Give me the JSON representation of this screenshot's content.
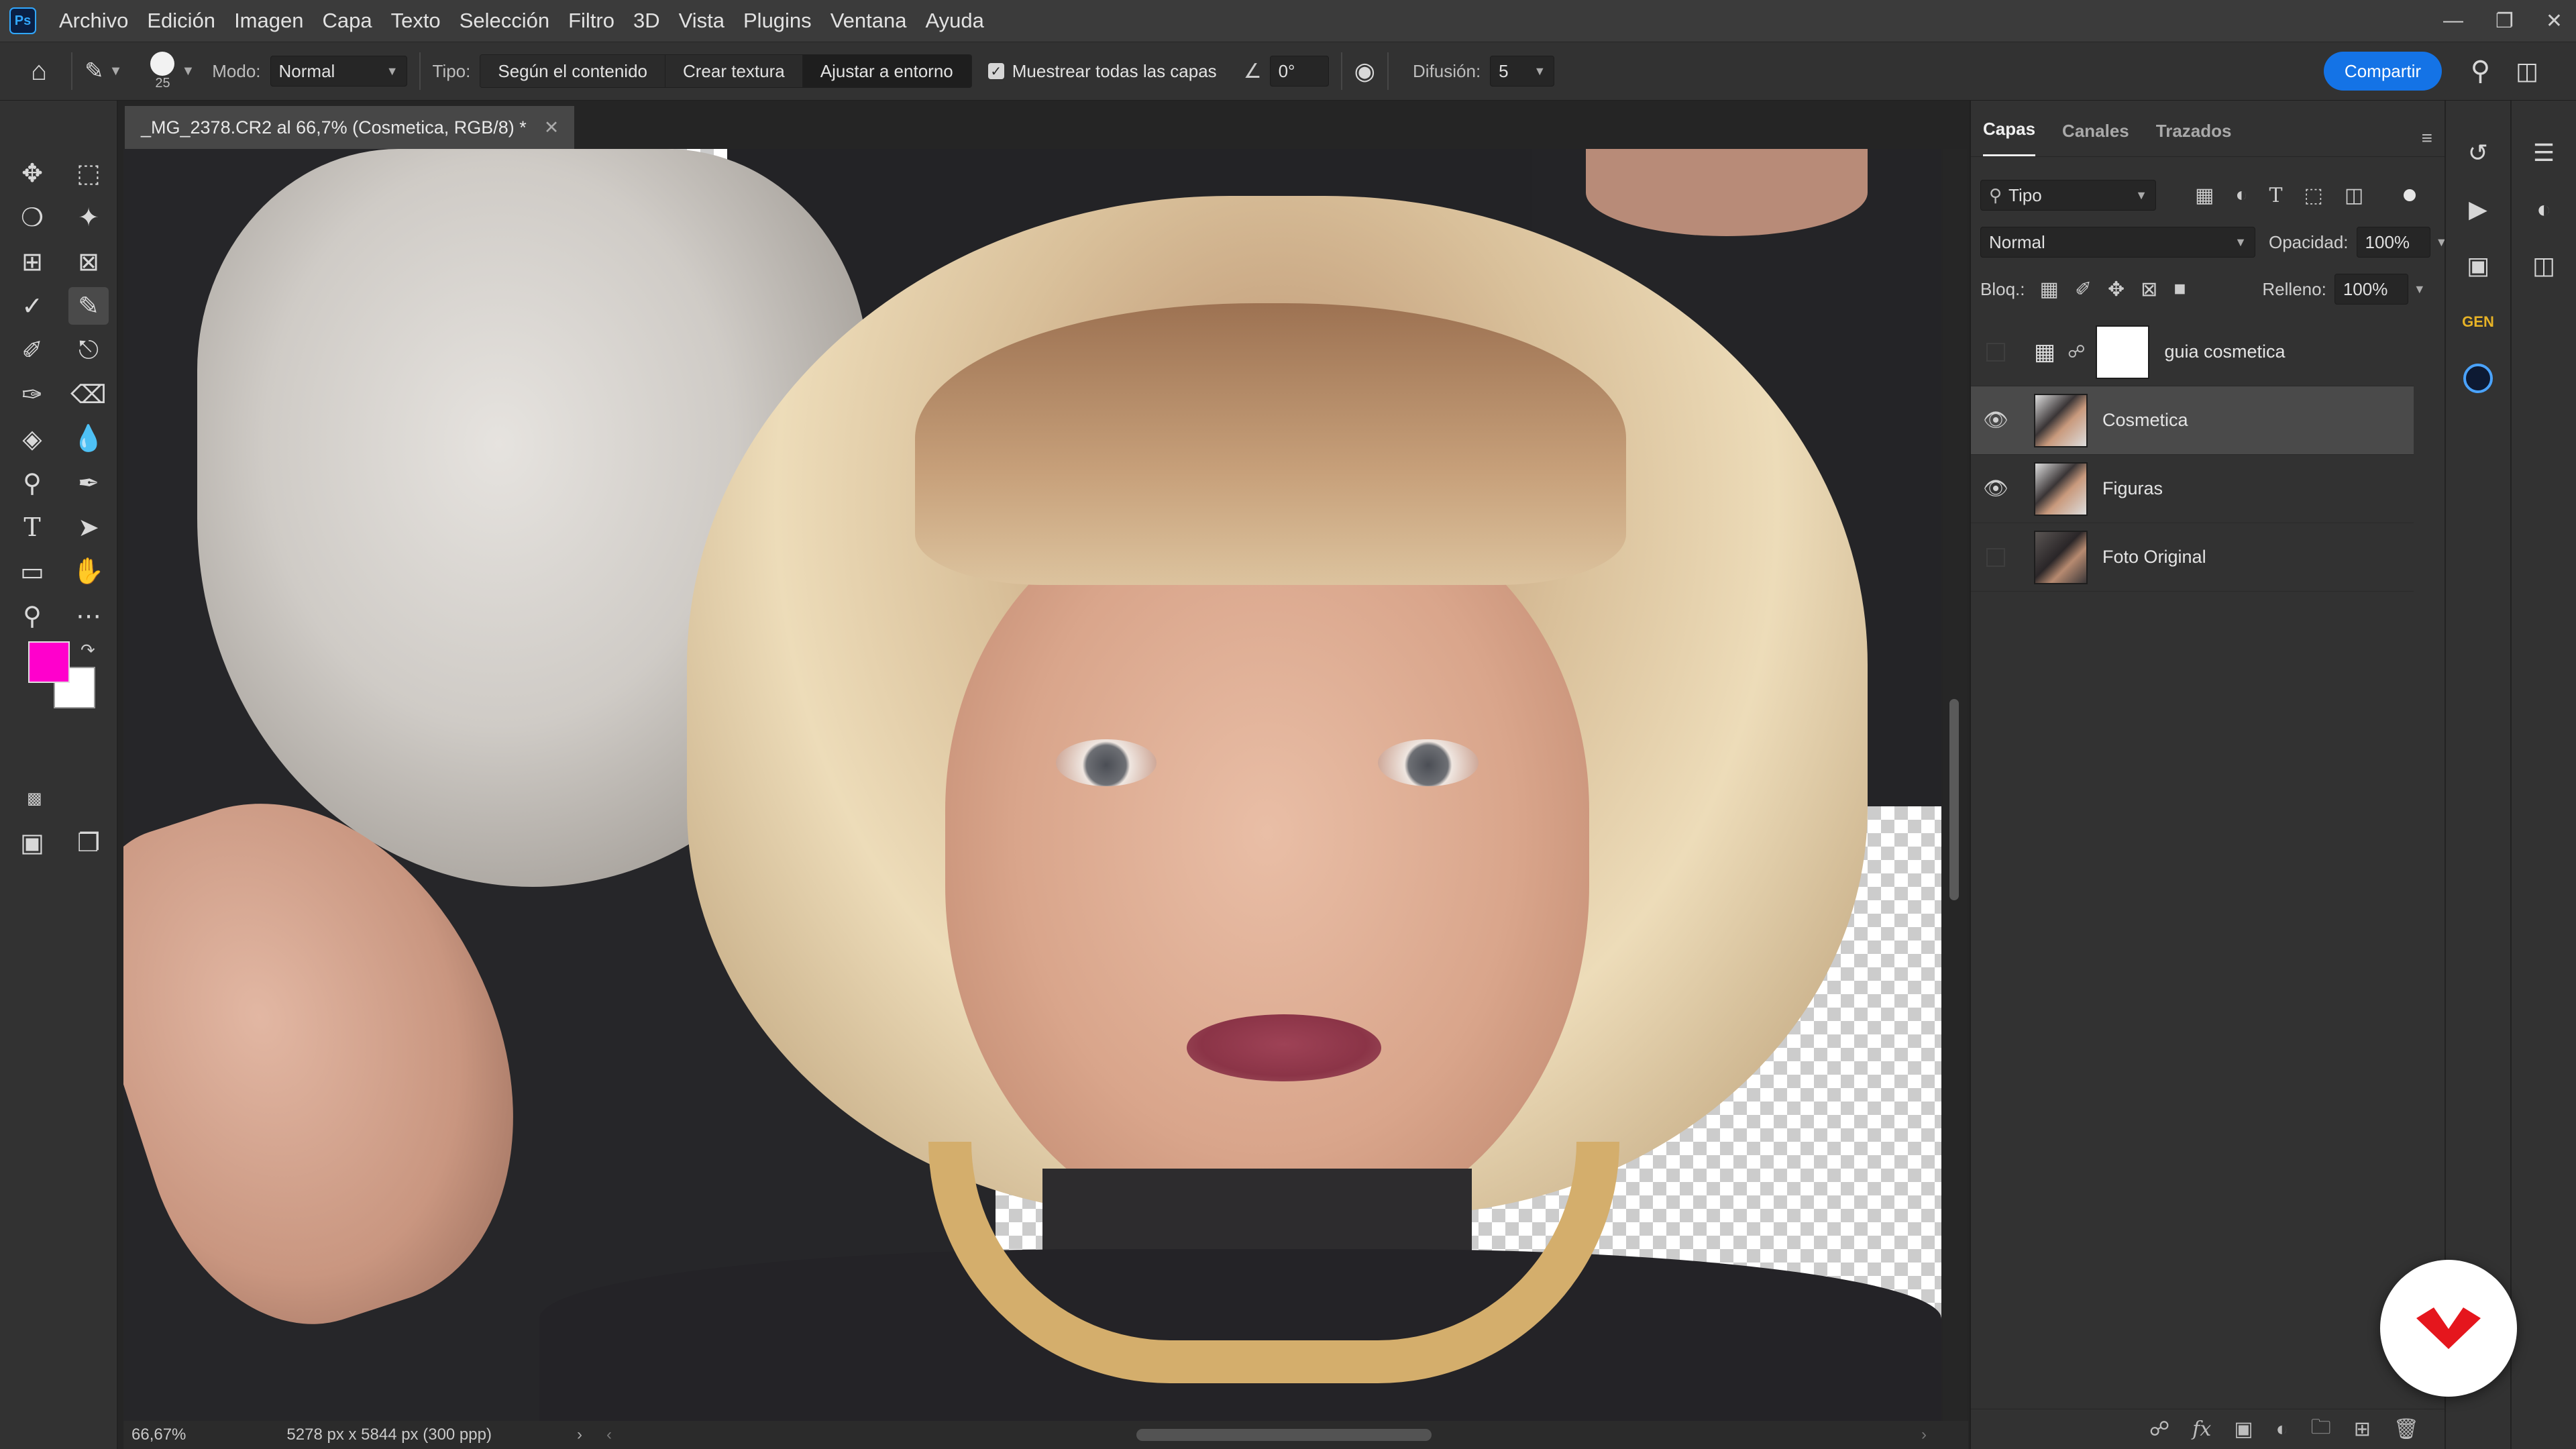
{
  "menubar": {
    "items": [
      "Archivo",
      "Edición",
      "Imagen",
      "Capa",
      "Texto",
      "Selección",
      "Filtro",
      "3D",
      "Vista",
      "Plugins",
      "Ventana",
      "Ayuda"
    ],
    "app_logo": "Ps"
  },
  "options": {
    "brush_size": "25",
    "mode_label": "Modo:",
    "mode_value": "Normal",
    "type_label": "Tipo:",
    "type_options": [
      "Según el contenido",
      "Crear textura",
      "Ajustar a entorno"
    ],
    "sample_all_label": "Muestrear todas las capas",
    "angle_value": "0°",
    "diffusion_label": "Difusión:",
    "diffusion_value": "5",
    "share_label": "Compartir"
  },
  "document": {
    "tab_title": "_MG_2378.CR2 al 66,7% (Cosmetica, RGB/8) *"
  },
  "status": {
    "zoom": "66,67%",
    "doc_info": "5278 px x 5844 px (300 ppp)"
  },
  "layers_panel": {
    "tabs": [
      "Capas",
      "Canales",
      "Trazados"
    ],
    "filter_label": "Tipo",
    "blend_mode": "Normal",
    "opacity_label": "Opacidad:",
    "opacity_value": "100%",
    "lock_label": "Bloq.:",
    "fill_label": "Relleno:",
    "fill_value": "100%",
    "layers": [
      {
        "name": "guia cosmetica",
        "visible": false,
        "selected": false
      },
      {
        "name": "Cosmetica",
        "visible": true,
        "selected": true
      },
      {
        "name": "Figuras",
        "visible": true,
        "selected": false
      },
      {
        "name": "Foto Original",
        "visible": false,
        "selected": false
      }
    ]
  },
  "colors": {
    "foreground": "#ff00cc",
    "background": "#ffffff",
    "accent": "#1473e6"
  }
}
